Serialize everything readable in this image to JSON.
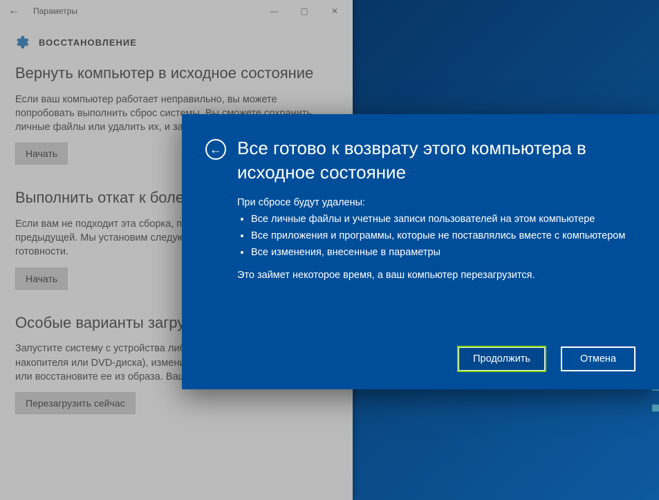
{
  "titlebar": {
    "title": "Параметры",
    "back_glyph": "←",
    "min_glyph": "—",
    "max_glyph": "▢",
    "close_glyph": "✕"
  },
  "header": {
    "page_title": "ВОССТАНОВЛЕНИЕ"
  },
  "sections": {
    "reset": {
      "heading": "Вернуть компьютер в исходное состояние",
      "body": "Если ваш компьютер работает неправильно, вы можете попробовать выполнить сброс системы. Вы сможете сохранить личные файлы или удалить их, и затем переустановить Windows.",
      "button": "Начать"
    },
    "rollback": {
      "heading": "Выполнить откат к более ранней сборке",
      "body": "Если вам не подходит эта сборка, попробуйте выполнить откат к предыдущей. Мы установим следующую сборку по мере ее готовности.",
      "button": "Начать"
    },
    "advanced": {
      "heading": "Особые варианты загрузки",
      "body": "Запустите систему с устройства либо диска (например, USB-накопителя или DVD-диска), измените параметры загрузки Windows или восстановите ее из образа. Ваш компьютер перезагрузится.",
      "button": "Перезагрузить сейчас"
    }
  },
  "dialog": {
    "back_glyph": "←",
    "title": "Все готово к возврату этого компьютера в исходное состояние",
    "intro": "При сбросе будут удалены:",
    "bullets": [
      "Все личные файлы и учетные записи пользователей на этом компьютере",
      "Все приложения и программы, которые не поставлялись вместе с компьютером",
      "Все изменения, внесенные в параметры"
    ],
    "note": "Это займет некоторое время, а ваш компьютер перезагрузится.",
    "primary_button": "Продолжить",
    "secondary_button": "Отмена"
  }
}
